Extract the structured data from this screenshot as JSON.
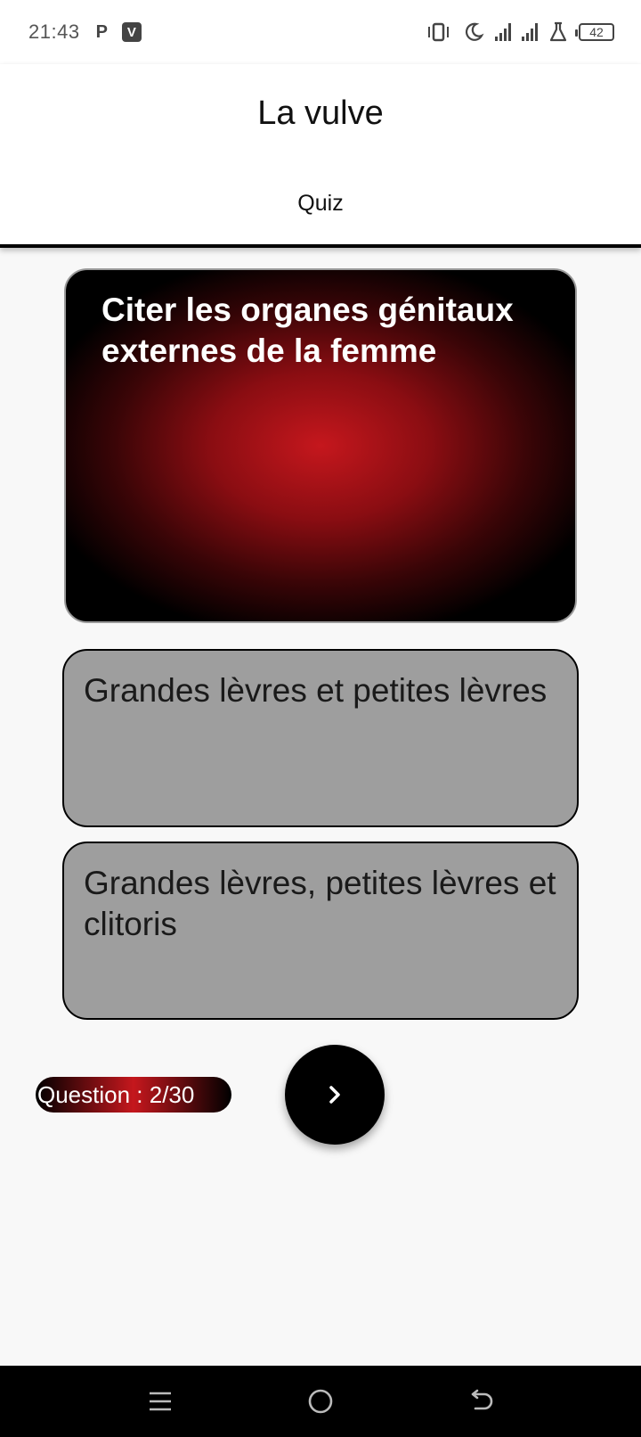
{
  "status_bar": {
    "time": "21:43",
    "left_icons": [
      "p-icon",
      "v-app-icon"
    ],
    "p_glyph": "P",
    "v_glyph": "V",
    "right_icons": [
      "vibrate-icon",
      "moon-icon",
      "signal-icon",
      "signal-icon",
      "flask-icon",
      "battery-icon"
    ],
    "battery_level": "42"
  },
  "header": {
    "title": "La vulve",
    "tab_label": "Quiz"
  },
  "question": {
    "text": "Citer les organes génitaux externes de la femme"
  },
  "answers": [
    {
      "text": "Grandes lèvres et petites lèvres"
    },
    {
      "text": "Grandes lèvres, petites lèvres et clitoris"
    }
  ],
  "footer": {
    "counter_label": "Question : 2/30",
    "next_icon": "chevron-right-icon"
  },
  "nav_bar": {
    "buttons": [
      "menu-icon",
      "home-icon",
      "back-icon"
    ]
  },
  "colors": {
    "accent_red": "#c5171d",
    "answer_bg": "#9e9e9e",
    "header_border": "#000000"
  }
}
